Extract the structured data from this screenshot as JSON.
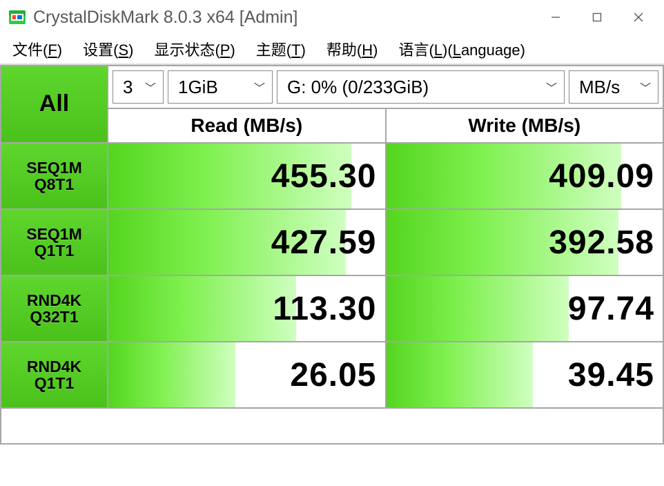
{
  "window": {
    "title": "CrystalDiskMark 8.0.3 x64 [Admin]"
  },
  "menu": {
    "file": {
      "label": "文件(",
      "key": "F",
      "tail": ")"
    },
    "setting": {
      "label": "设置(",
      "key": "S",
      "tail": ")"
    },
    "display": {
      "label": "显示状态(",
      "key": "P",
      "tail": ")"
    },
    "theme": {
      "label": "主题(",
      "key": "T",
      "tail": ")"
    },
    "help": {
      "label": "帮助(",
      "key": "H",
      "tail": ")"
    },
    "lang": {
      "label": "语言(",
      "key": "L",
      "tail": ")(",
      "key2": "L",
      "tail2": "anguage)"
    }
  },
  "controls": {
    "count": "3",
    "size": "1GiB",
    "drive": "G: 0% (0/233GiB)",
    "unit": "MB/s"
  },
  "buttons": {
    "all": "All",
    "t1_l1": "SEQ1M",
    "t1_l2": "Q8T1",
    "t2_l1": "SEQ1M",
    "t2_l2": "Q1T1",
    "t3_l1": "RND4K",
    "t3_l2": "Q32T1",
    "t4_l1": "RND4K",
    "t4_l2": "Q1T1"
  },
  "headers": {
    "read": "Read (MB/s)",
    "write": "Write (MB/s)"
  },
  "results": {
    "r1_read": "455.30",
    "r1_write": "409.09",
    "r2_read": "427.59",
    "r2_write": "392.58",
    "r3_read": "113.30",
    "r3_write": "97.74",
    "r4_read": "26.05",
    "r4_write": "39.45"
  },
  "bars": {
    "r1_read": "88",
    "r1_write": "85",
    "r2_read": "86",
    "r2_write": "84",
    "r3_read": "68",
    "r3_write": "66",
    "r4_read": "46",
    "r4_write": "53"
  }
}
